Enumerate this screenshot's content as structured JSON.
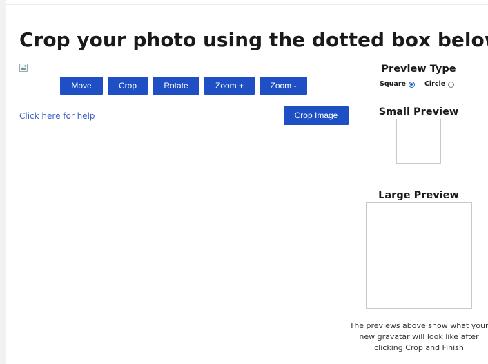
{
  "page": {
    "title": "Crop your photo using the dotted box below",
    "help_link": "Click here for help"
  },
  "toolbar": {
    "move_label": "Move",
    "crop_label": "Crop",
    "rotate_label": "Rotate",
    "zoom_in_label": "Zoom +",
    "zoom_out_label": "Zoom -",
    "crop_image_label": "Crop Image"
  },
  "sidebar": {
    "preview_type_heading": "Preview Type",
    "options": [
      {
        "label": "Square",
        "selected": true
      },
      {
        "label": "Circle",
        "selected": false
      }
    ],
    "small_preview_heading": "Small Preview",
    "large_preview_heading": "Large Preview",
    "note": "The previews above show what your new gravatar will look like after clicking Crop and Finish"
  },
  "colors": {
    "button_bg": "#1f4fc4",
    "link": "#3b5fc2"
  }
}
